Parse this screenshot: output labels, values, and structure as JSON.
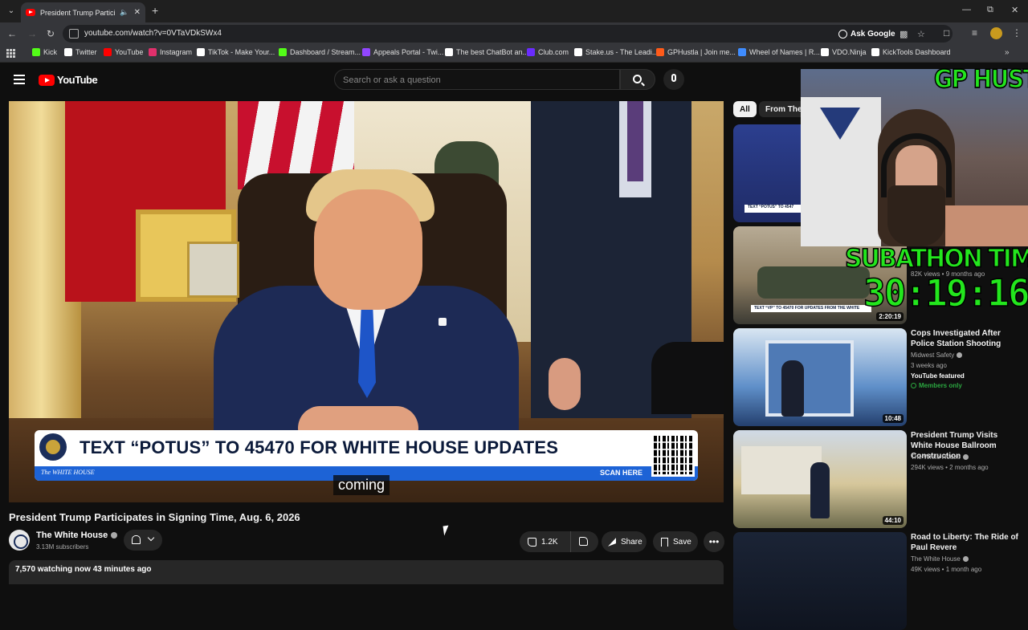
{
  "browser": {
    "tab_title": "President Trump Participate",
    "url": "youtube.com/watch?v=0VTaVDkSWx4",
    "ask_google": "Ask Google",
    "bookmarks": [
      {
        "label": "Kick",
        "color": "#53fc18"
      },
      {
        "label": "Twitter",
        "color": "#ffffff"
      },
      {
        "label": "YouTube",
        "color": "#ff0000"
      },
      {
        "label": "Instagram",
        "color": "#e1306c"
      },
      {
        "label": "TikTok - Make Your...",
        "color": "#ffffff"
      },
      {
        "label": "Dashboard / Stream...",
        "color": "#53fc18"
      },
      {
        "label": "Appeals Portal - Twi...",
        "color": "#9146ff"
      },
      {
        "label": "The best ChatBot an...",
        "color": "#ffffff"
      },
      {
        "label": "Club.com",
        "color": "#6a2cff"
      },
      {
        "label": "Stake.us - The Leadi...",
        "color": "#ffffff"
      },
      {
        "label": "GPHustla | Join me...",
        "color": "#ff5b1a"
      },
      {
        "label": "Wheel of Names | R...",
        "color": "#3f8cff"
      },
      {
        "label": "VDO.Ninja",
        "color": "#ffffff"
      },
      {
        "label": "KickTools Dashboard",
        "color": "#ffffff"
      }
    ]
  },
  "youtube": {
    "logo_text": "YouTube",
    "search_placeholder": "Search or ask a question"
  },
  "video": {
    "banner_text": "TEXT “POTUS” TO 45470 FOR WHITE HOUSE UPDATES",
    "banner_wh": "The WHITE HOUSE",
    "banner_scan": "SCAN HERE",
    "caption": "coming",
    "title": "President Trump Participates in Signing Time, Aug. 6, 2026",
    "channel": "The White House",
    "subscribers": "3.13M subscribers",
    "likes": "1.2K",
    "share": "Share",
    "save": "Save",
    "more": "•••",
    "meta": "7,570 watching now  43 minutes ago"
  },
  "sidebar": {
    "chips": [
      "All",
      "From The White House"
    ],
    "recs": [
      {
        "title": "",
        "channel": "",
        "meta": "",
        "duration": "",
        "strip": "TEXT “POTUS” TO 4547"
      },
      {
        "title": "",
        "channel": "",
        "meta": "82K views • 9 months ago",
        "duration": "2:20:19",
        "strip": "TEXT “VP” TO 45470 FOR UPDATES FROM THE WHITE"
      },
      {
        "title": "Cops Investigated After Police Station Shooting",
        "channel": "Midwest Safety",
        "meta": "3 weeks ago",
        "badge": "YouTube featured",
        "members": "Members only",
        "duration": "10:48"
      },
      {
        "title": "President Trump Visits White House Ballroom Construction",
        "channel": "The White House",
        "meta": "294K views • 2 months ago",
        "duration": "44:10"
      },
      {
        "title": "Road to Liberty: The Ride of Paul Revere",
        "channel": "The White House",
        "meta": "49K views • 1 month ago",
        "duration": ""
      }
    ]
  },
  "overlay": {
    "name": "GP HUSTLA",
    "subathon_label": "SUBATHON TIMER",
    "timer": "30:19:16"
  }
}
